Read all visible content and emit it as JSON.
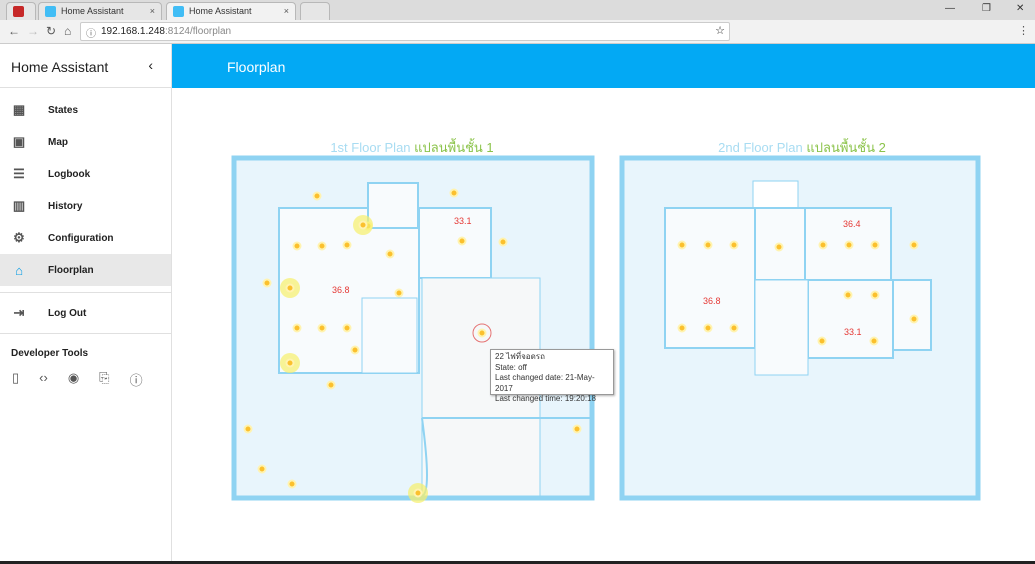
{
  "browser": {
    "tabs": [
      {
        "label": "Home Assistant"
      },
      {
        "label": "Home Assistant"
      }
    ],
    "url_host": "192.168.1.248",
    "url_rest": ":8124/floorplan"
  },
  "sidebar": {
    "title": "Home Assistant",
    "items": [
      {
        "label": "States",
        "icon": "grid-icon"
      },
      {
        "label": "Map",
        "icon": "map-icon"
      },
      {
        "label": "Logbook",
        "icon": "list-icon"
      },
      {
        "label": "History",
        "icon": "chart-icon"
      },
      {
        "label": "Configuration",
        "icon": "gear-icon"
      },
      {
        "label": "Floorplan",
        "icon": "home-icon"
      }
    ],
    "logout": "Log Out",
    "dev_title": "Developer Tools"
  },
  "header": {
    "title": "Floorplan"
  },
  "floor1": {
    "title_en": "1st  Floor  Plan",
    "title_th": "แปลนพื้นชั้น 1",
    "temps": [
      "33.1",
      "36.8"
    ]
  },
  "floor2": {
    "title_en": "2nd  Floor  Plan",
    "title_th": "แปลนพื้นชั้น 2",
    "temps": [
      "36.4",
      "36.8",
      "33.1"
    ]
  },
  "tooltip": {
    "name": "22 ไฟที่จอดรถ",
    "state": "State: off",
    "date": "Last changed date: 21-May-2017",
    "time": "Last changed time: 19:20:18"
  },
  "colors": {
    "accent": "#03a9f4",
    "light": "#f5c518",
    "temp": "#e53935"
  }
}
